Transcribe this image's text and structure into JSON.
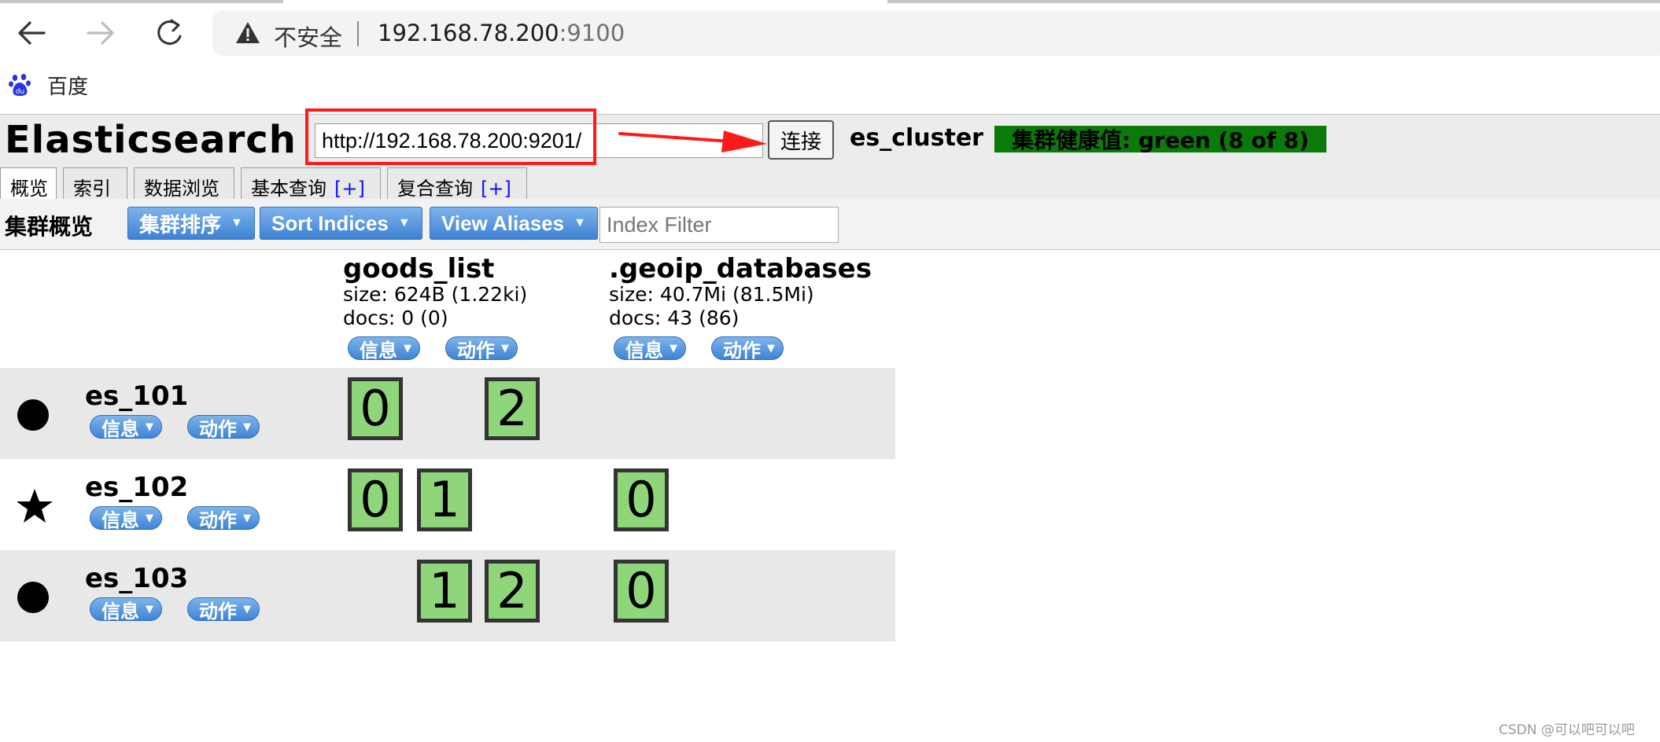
{
  "browser": {
    "insecure_label": "不安全",
    "url_host": "192.168.78.200",
    "url_port": ":9100",
    "bookmark_label": "百度",
    "bookmark_icon": "baidu-paw-icon"
  },
  "header": {
    "app_title": "Elasticsearch",
    "connect_url": "http://192.168.78.200:9201/",
    "connect_button": "连接",
    "cluster_name": "es_cluster",
    "cluster_health": "集群健康值: green (8 of 8)",
    "health_color": "#0a7a0a",
    "annotation_color": "#ff1a1a"
  },
  "tabs": [
    {
      "label": "概览",
      "plus": ""
    },
    {
      "label": "索引",
      "plus": ""
    },
    {
      "label": "数据浏览",
      "plus": ""
    },
    {
      "label": "基本查询",
      "plus": "[+]"
    },
    {
      "label": "复合查询",
      "plus": "[+]"
    }
  ],
  "toolbar": {
    "title": "集群概览",
    "sort_cluster": "集群排序",
    "sort_indices": "Sort Indices",
    "view_aliases": "View Aliases",
    "index_filter_placeholder": "Index Filter"
  },
  "actions": {
    "info": "信息",
    "action": "动作"
  },
  "indices": [
    {
      "name": "goods_list",
      "size": "size: 624B (1.22ki)",
      "docs": "docs: 0 (0)"
    },
    {
      "name": ".geoip_databases",
      "size": "size: 40.7Mi (81.5Mi)",
      "docs": "docs: 43 (86)"
    }
  ],
  "nodes": [
    {
      "name": "es_101",
      "marker": "circle",
      "shards": [
        "0",
        "2"
      ]
    },
    {
      "name": "es_102",
      "marker": "star",
      "shards": [
        "0",
        "1",
        "0"
      ]
    },
    {
      "name": "es_103",
      "marker": "circle",
      "shards": [
        "1",
        "2",
        "0"
      ]
    }
  ],
  "colors": {
    "shard_fill": "#8fd67a",
    "button_blue": "#3d82d4"
  },
  "watermark": "CSDN @可以吧可以吧"
}
